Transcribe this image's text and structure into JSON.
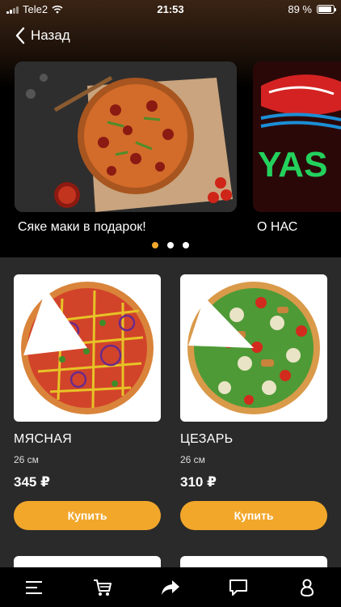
{
  "status_bar": {
    "carrier": "Tele2",
    "time": "21:53",
    "battery": "89 %",
    "battery_level": 0.89
  },
  "nav": {
    "back_label": "Назад"
  },
  "banners": [
    {
      "label": "Сяке маки в подарок!"
    },
    {
      "label": "О НАС"
    }
  ],
  "carousel": {
    "pages": 3,
    "active": 0
  },
  "products": [
    {
      "name": "МЯСНАЯ",
      "size": "26 см",
      "price": "345 ₽",
      "button": "Купить"
    },
    {
      "name": "ЦЕЗАРЬ",
      "size": "26 см",
      "price": "310 ₽",
      "button": "Купить"
    }
  ],
  "tabbar": {
    "icons": [
      "menu-icon",
      "cart-icon",
      "share-icon",
      "chat-icon",
      "profile-icon"
    ]
  },
  "colors": {
    "accent": "#f2a72b",
    "background": "#2a2a2a",
    "header": "#000000"
  }
}
